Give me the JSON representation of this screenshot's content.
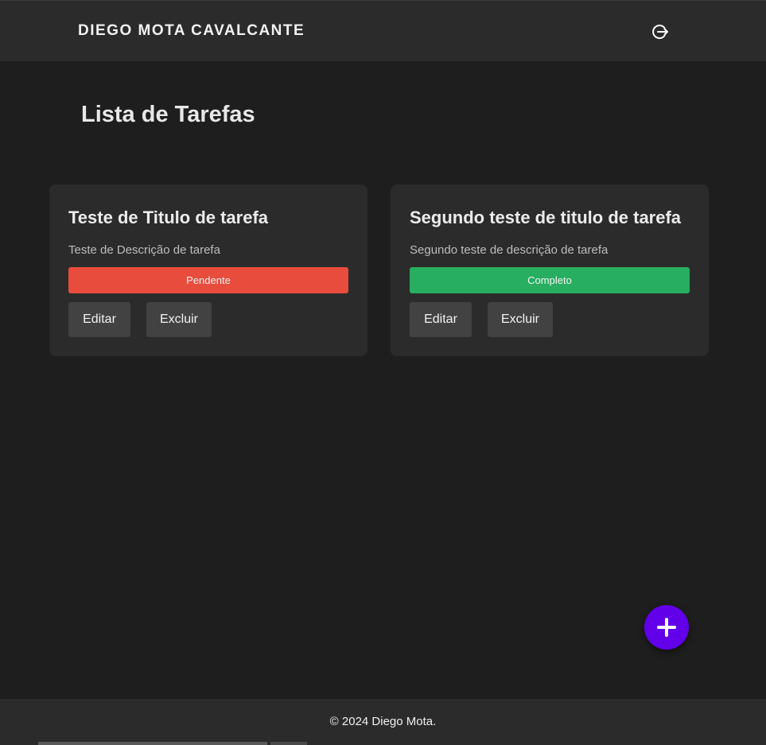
{
  "header": {
    "brand": "DIEGO MOTA CAVALCANTE",
    "logout_icon": "logout-icon"
  },
  "main": {
    "title": "Lista de Tarefas",
    "tasks": [
      {
        "title": "Teste de Titulo de tarefa",
        "description": "Teste de Descrição de tarefa",
        "status": "Pendente",
        "status_color": "#e74c3c",
        "edit_label": "Editar",
        "delete_label": "Excluir"
      },
      {
        "title": "Segundo teste de titulo de tarefa",
        "description": "Segundo teste de descrição de tarefa",
        "status": "Completo",
        "status_color": "#27ae60",
        "edit_label": "Editar",
        "delete_label": "Excluir"
      }
    ]
  },
  "fab": {
    "icon": "plus-icon",
    "color": "#6200ea"
  },
  "footer": {
    "text": "© 2024 Diego Mota."
  },
  "colors": {
    "background": "#1e1e1e",
    "surface": "#2b2b2b",
    "button": "#424242"
  }
}
